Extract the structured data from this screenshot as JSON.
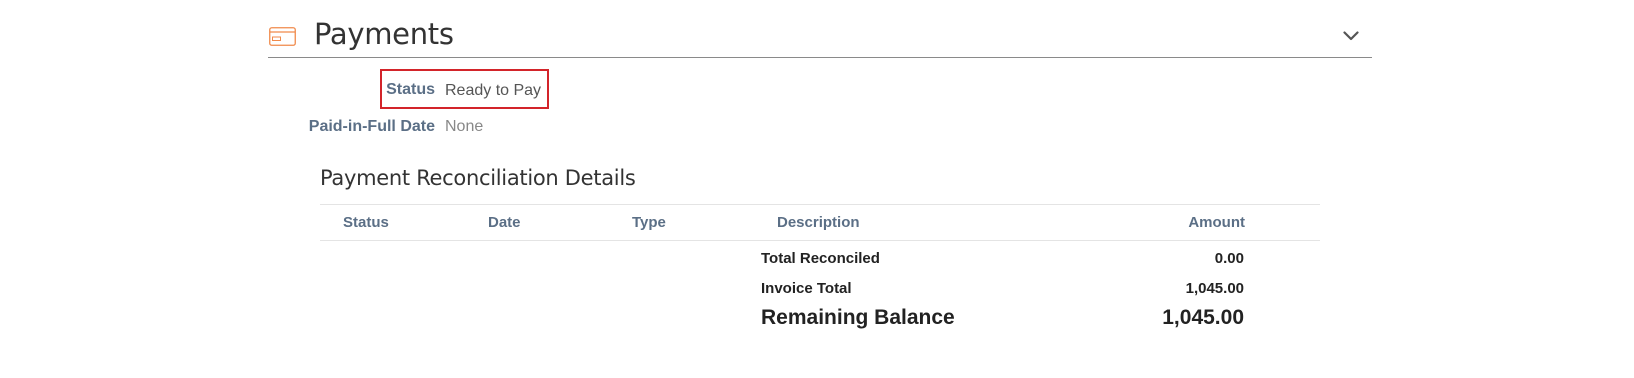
{
  "section": {
    "title": "Payments",
    "icon": "credit-card-icon",
    "accent_color": "#f08a4b",
    "toggle_icon": "chevron-down-icon"
  },
  "fields": {
    "status": {
      "label": "Status",
      "value": "Ready to Pay"
    },
    "paid_in_full": {
      "label": "Paid-in-Full Date",
      "value": "None"
    }
  },
  "highlight_color": "#d3242a",
  "reconciliation": {
    "heading": "Payment Reconciliation Details",
    "columns": [
      "Status",
      "Date",
      "Type",
      "Description",
      "Amount"
    ],
    "totals": {
      "reconciled": {
        "label": "Total Reconciled",
        "value": "0.00"
      },
      "invoice": {
        "label": "Invoice Total",
        "value": "1,045.00"
      },
      "remaining": {
        "label": "Remaining Balance",
        "value": "1,045.00"
      }
    }
  }
}
